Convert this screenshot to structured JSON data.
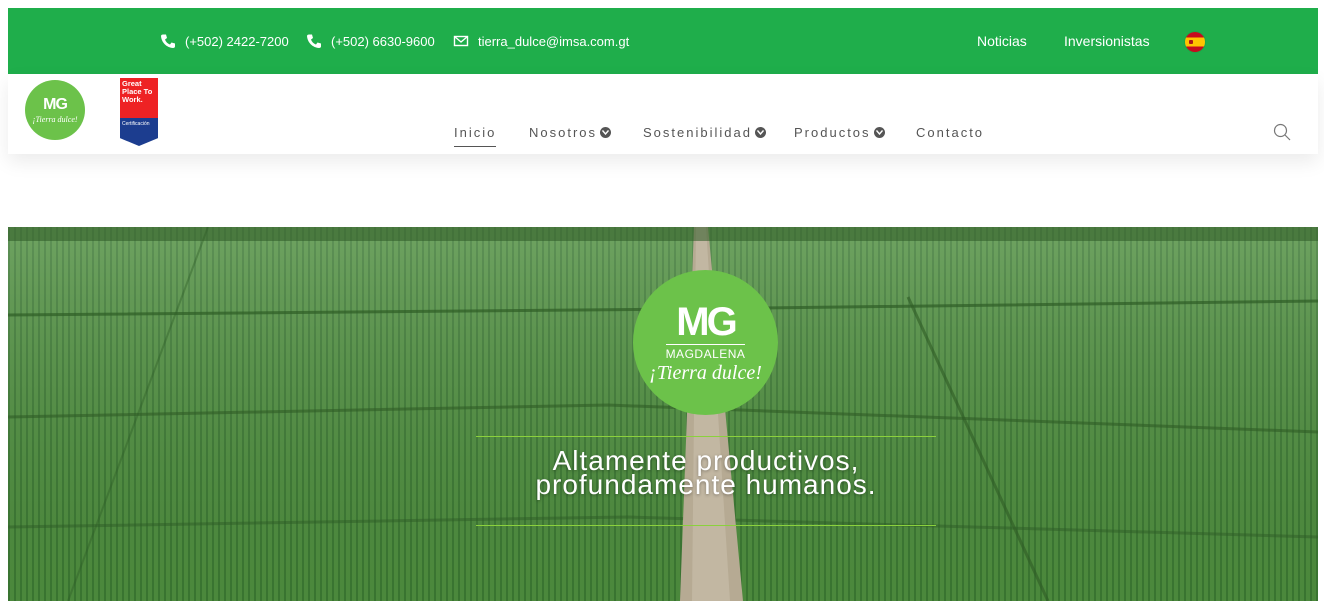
{
  "topbar": {
    "phone1": "(+502) 2422-7200",
    "phone2": "(+502) 6630-9600",
    "email": "tierra_dulce@imsa.com.gt",
    "links": [
      "Noticias",
      "Inversionistas"
    ],
    "language_flag": "spain-flag-icon"
  },
  "header": {
    "logo": {
      "mark": "MG",
      "tagline": "¡Tierra dulce!"
    },
    "badge": {
      "text": "Great Place To Work.",
      "cert": "Certificación"
    },
    "nav": [
      "Inicio",
      "Nosotros",
      "Sostenibilidad",
      "Productos",
      "Contacto"
    ],
    "search_icon": "search-icon"
  },
  "hero": {
    "logo": {
      "mark": "MG",
      "brand": "MAGDALENA",
      "tagline": "¡Tierra dulce!"
    },
    "headline_line1": "Altamente productivos,",
    "headline_line2": "profundamente humanos."
  },
  "colors": {
    "brand_green": "#1fae4b",
    "logo_green": "#6cc24a",
    "accent_line": "#8bd13d"
  }
}
